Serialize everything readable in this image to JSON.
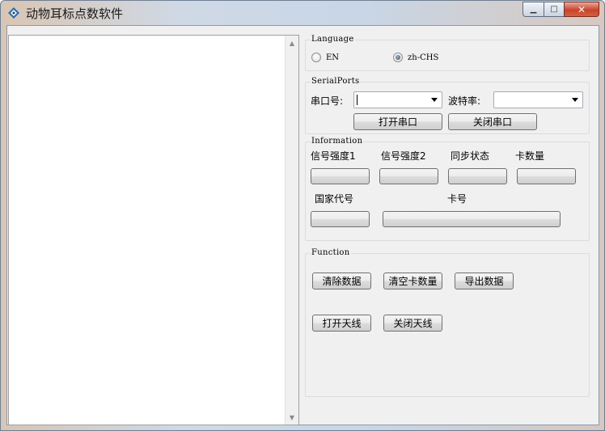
{
  "window": {
    "title": "动物耳标点数软件",
    "caption": {
      "minimize": "▁",
      "maximize": "□",
      "close": "✕"
    }
  },
  "list": {
    "scroll_up": "▲",
    "scroll_down": "▼"
  },
  "language": {
    "group_title": "Language",
    "options": [
      {
        "label": "EN",
        "checked": false
      },
      {
        "label": "zh-CHS",
        "checked": true
      }
    ]
  },
  "serial": {
    "group_title": "SerialPorts",
    "port_label": "串口号:",
    "port_value": "",
    "baud_label": "波特率:",
    "baud_value": "",
    "open_button": "打开串口",
    "close_button": "关闭串口"
  },
  "information": {
    "group_title": "Information",
    "signal1_label": "信号强度1",
    "signal2_label": "信号强度2",
    "sync_label": "同步状态",
    "card_count_label": "卡数量",
    "country_label": "国家代号",
    "card_no_label": "卡号"
  },
  "function": {
    "group_title": "Function",
    "clear_data": "清除数据",
    "clear_count": "清空卡数量",
    "export_data": "导出数据",
    "open_antenna": "打开天线",
    "close_antenna": "关闭天线"
  },
  "colors": {
    "client_bg": "#f0f0f0",
    "close_button": "#c8442c",
    "title_accent": "#2b6cb0"
  }
}
